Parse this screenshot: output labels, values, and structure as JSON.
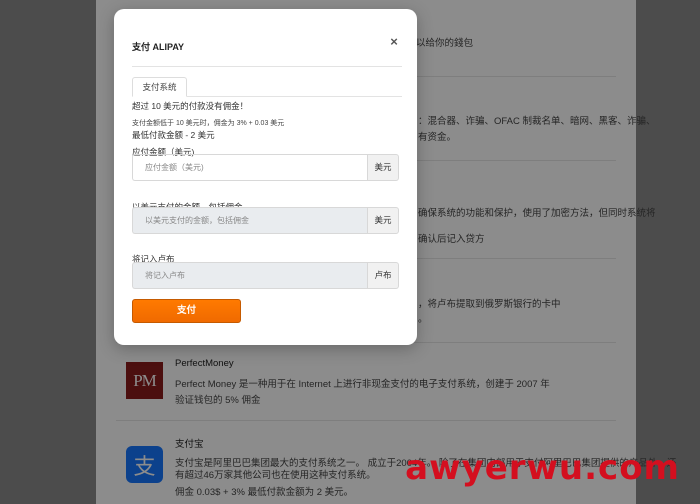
{
  "background": {
    "line_1": "以给你的錢包",
    "line_2": "：混合器、诈骗、OFAC 制裁名单、暗网、黑客、诈骗、",
    "line_3": "有资金。",
    "line_4": "确保系统的功能和保护，使用了加密方法，但同时系统将",
    "line_5": "确认后记入贷方",
    "line_6": "，将卢布提取到俄罗斯银行的卡中",
    "line_7": "。",
    "perfectmoney": {
      "logo_text": "PM",
      "title": "PerfectMoney",
      "desc": "Perfect Money 是一种用于在 Internet 上进行非现金支付的电子支付系统，创建于 2007 年",
      "fee": "验证钱包的 5% 佣金"
    },
    "alipay": {
      "logo_text": "支",
      "title": "支付宝",
      "desc_1": "支付宝是阿里巴巴集团最大的支付系统之一。 成立于2004年。 除了在集团内部用于支付阿里巴巴集团提供的产品外，还",
      "desc_2": "有超过46万家其他公司也在使用这种支付系统。",
      "fee": "佣金 0.03$ + 3% 最低付款金额为 2 美元。"
    },
    "watermark": "awyerwu.com"
  },
  "modal": {
    "title": "支付 ALIPAY",
    "close_label": "×",
    "tab_label": "支付系统",
    "note_no_fee": "超过 10 美元的付款没有佣金！",
    "note_fee": "支付金额低于 10 美元时，佣金为 3% + 0.03 美元",
    "note_min": "最低付款金额 - 2 美元",
    "amount": {
      "label": "应付金额（美元)",
      "placeholder": "应付金额（美元)",
      "suffix": "美元"
    },
    "amount_with_fee": {
      "label": "以美元支付的金额，包括佣金",
      "placeholder": "以美元支付的金额，包括佣金",
      "suffix": "美元"
    },
    "credited": {
      "label": "将记入卢布",
      "placeholder": "将记入卢布",
      "suffix": "卢布"
    },
    "pay_button": "支付"
  }
}
